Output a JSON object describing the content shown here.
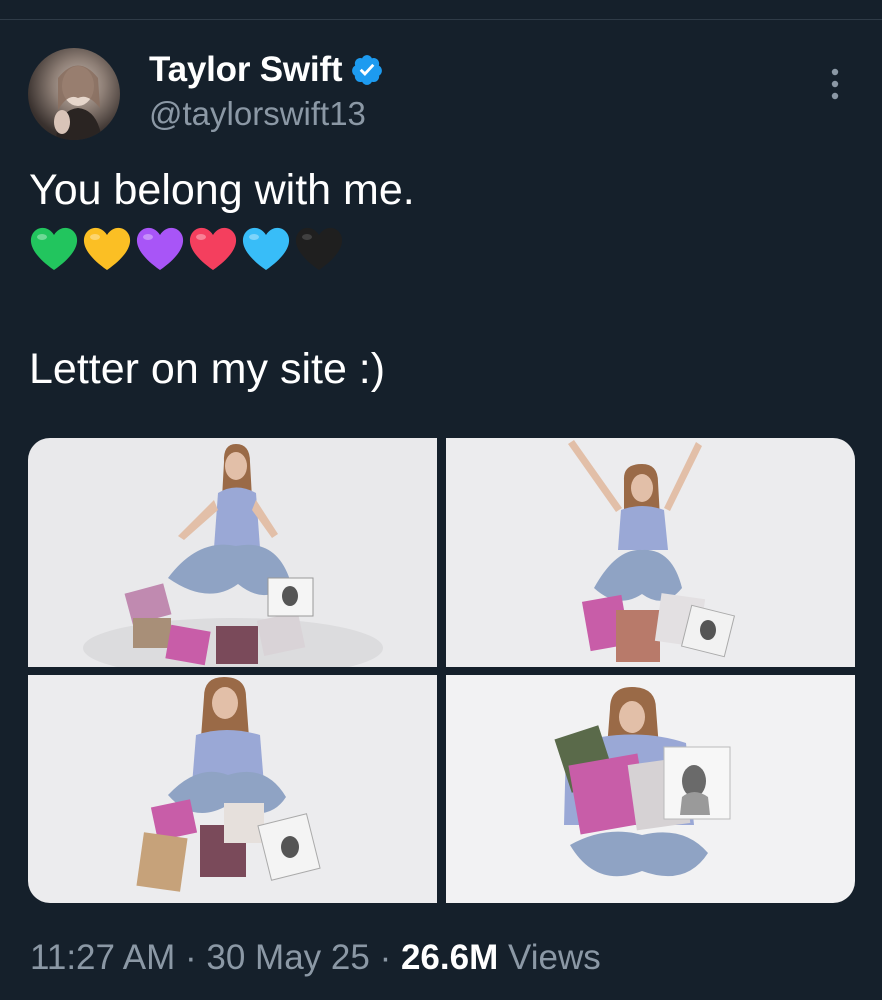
{
  "author": {
    "display_name": "Taylor Swift",
    "handle": "@taylorswift13",
    "verified": true,
    "avatar_icon": "profile-avatar"
  },
  "tweet": {
    "line1": "You belong with me.",
    "hearts": [
      "green-heart",
      "yellow-heart",
      "purple-heart",
      "red-heart",
      "light-blue-heart",
      "black-heart"
    ],
    "heart_colors": [
      "#22c55e",
      "#fbbf24",
      "#a855f7",
      "#f43f5e",
      "#38bdf8",
      "#1f1f1f"
    ],
    "line3": "Letter on my site :)"
  },
  "media": {
    "count": 4,
    "photos": [
      "photo-1",
      "photo-2",
      "photo-3",
      "photo-4"
    ]
  },
  "meta": {
    "time": "11:27 AM",
    "sep1": "·",
    "date": "30 May 25",
    "sep2": "·",
    "views_count": "26.6M",
    "views_label": "Views"
  },
  "colors": {
    "background": "#15202b",
    "muted_text": "#8b98a5",
    "verified_badge": "#1d9bf0"
  },
  "icons": {
    "verified": "verified-badge-icon",
    "more": "more-options-icon"
  }
}
